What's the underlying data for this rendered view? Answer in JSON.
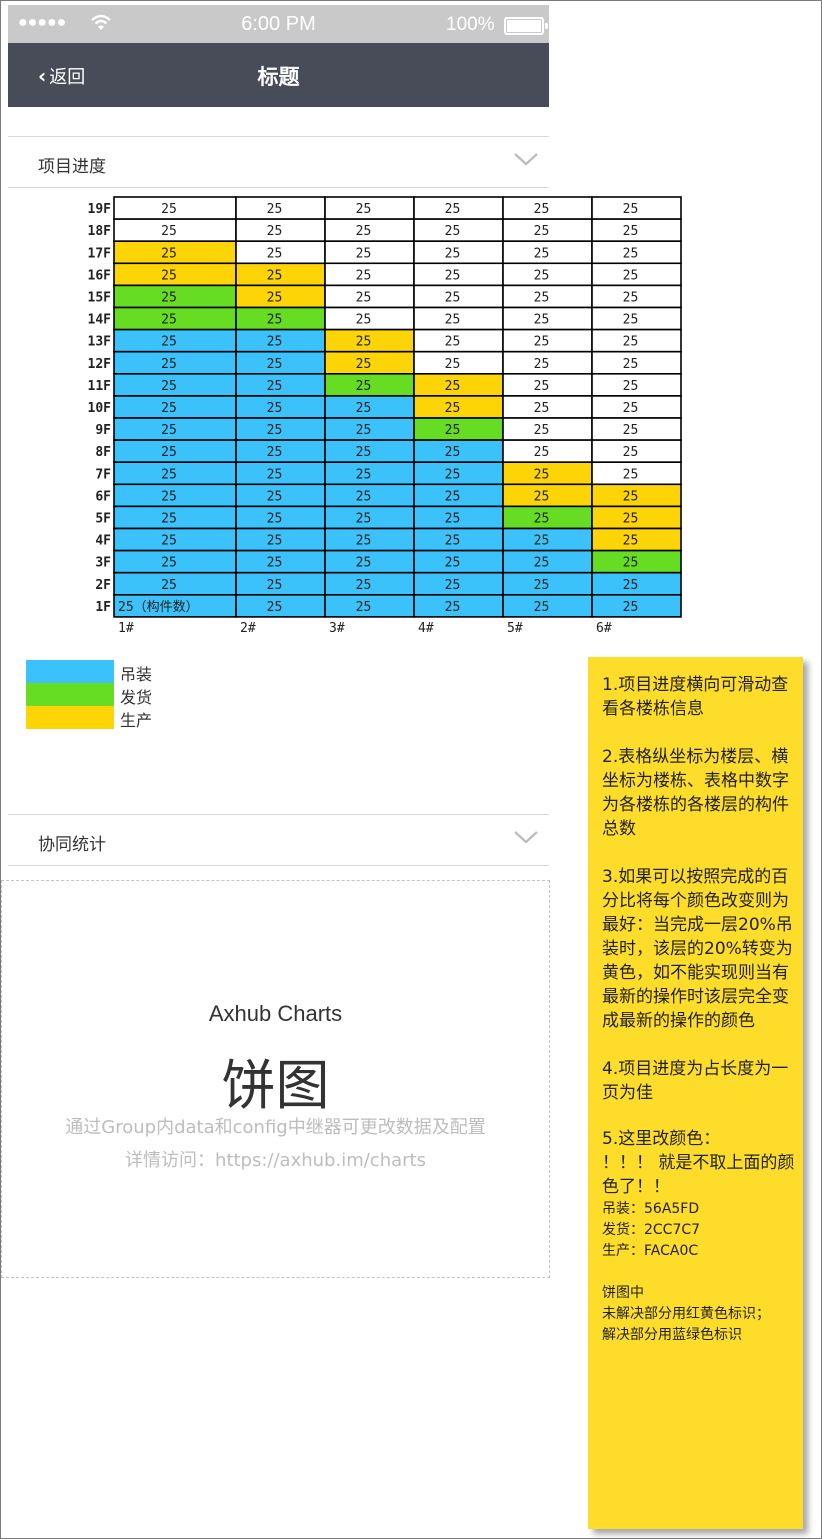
{
  "status_bar": {
    "signal": "●●●●●",
    "time": "6:00 PM",
    "battery_percent": "100%"
  },
  "nav": {
    "back_label": "返回",
    "title": "标题"
  },
  "sections": {
    "progress_label": "项目进度",
    "collab_label": "协同统计"
  },
  "chart_data": {
    "type": "table",
    "floors": [
      "19F",
      "18F",
      "17F",
      "16F",
      "15F",
      "14F",
      "13F",
      "12F",
      "11F",
      "10F",
      "9F",
      "8F",
      "7F",
      "6F",
      "5F",
      "4F",
      "3F",
      "2F",
      "1F"
    ],
    "buildings": [
      "1#",
      "2#",
      "3#",
      "4#",
      "5#",
      "6#"
    ],
    "cell_value": "25",
    "first_cell_text": "25（构件数）",
    "status_legend": {
      "B": "吊装",
      "G": "发货",
      "Y": "生产",
      "W": ""
    },
    "colors": {
      "B": "#3cc2fb",
      "G": "#66dd22",
      "Y": "#fdd405",
      "W": "#ffffff"
    },
    "status": [
      [
        "W",
        "W",
        "W",
        "W",
        "W",
        "W"
      ],
      [
        "W",
        "W",
        "W",
        "W",
        "W",
        "W"
      ],
      [
        "Y",
        "W",
        "W",
        "W",
        "W",
        "W"
      ],
      [
        "Y",
        "Y",
        "W",
        "W",
        "W",
        "W"
      ],
      [
        "G",
        "Y",
        "W",
        "W",
        "W",
        "W"
      ],
      [
        "G",
        "G",
        "W",
        "W",
        "W",
        "W"
      ],
      [
        "B",
        "B",
        "Y",
        "W",
        "W",
        "W"
      ],
      [
        "B",
        "B",
        "Y",
        "W",
        "W",
        "W"
      ],
      [
        "B",
        "B",
        "G",
        "Y",
        "W",
        "W"
      ],
      [
        "B",
        "B",
        "B",
        "Y",
        "W",
        "W"
      ],
      [
        "B",
        "B",
        "B",
        "G",
        "W",
        "W"
      ],
      [
        "B",
        "B",
        "B",
        "B",
        "W",
        "W"
      ],
      [
        "B",
        "B",
        "B",
        "B",
        "Y",
        "W"
      ],
      [
        "B",
        "B",
        "B",
        "B",
        "Y",
        "Y"
      ],
      [
        "B",
        "B",
        "B",
        "B",
        "G",
        "Y"
      ],
      [
        "B",
        "B",
        "B",
        "B",
        "B",
        "Y"
      ],
      [
        "B",
        "B",
        "B",
        "B",
        "B",
        "G"
      ],
      [
        "B",
        "B",
        "B",
        "B",
        "B",
        "B"
      ],
      [
        "B",
        "B",
        "B",
        "B",
        "B",
        "B"
      ]
    ]
  },
  "legend": [
    {
      "label": "吊装",
      "color": "#3cc2fb"
    },
    {
      "label": "发货",
      "color": "#66dd22"
    },
    {
      "label": "生产",
      "color": "#fdd405"
    }
  ],
  "placeholder": {
    "brand": "Axhub Charts",
    "title": "饼图",
    "description": "通过Group内data和config中继器可更改数据及配置",
    "link": "详情访问：https://axhub.im/charts"
  },
  "note": {
    "p1": "1.项目进度横向可滑动查看各楼栋信息",
    "p2": "2.表格纵坐标为楼层、横坐标为楼栋、表格中数字为各楼栋的各楼层的构件总数",
    "p3": "3.如果可以按照完成的百分比将每个颜色改变则为最好：当完成一层20%吊装时，该层的20%转变为黄色，如不能实现则当有最新的操作时该层完全变成最新的操作的颜色",
    "p4": "4.项目进度为占长度为一页为佳",
    "p5": "5.这里改颜色：\n！！！ 就是不取上面的颜色了！！",
    "colors": "吊装：56A5FD\n发货：2CC7C7\n生产：FACA0C",
    "pie": "饼图中\n未解决部分用红黄色标识；\n解决部分用蓝绿色标识"
  }
}
